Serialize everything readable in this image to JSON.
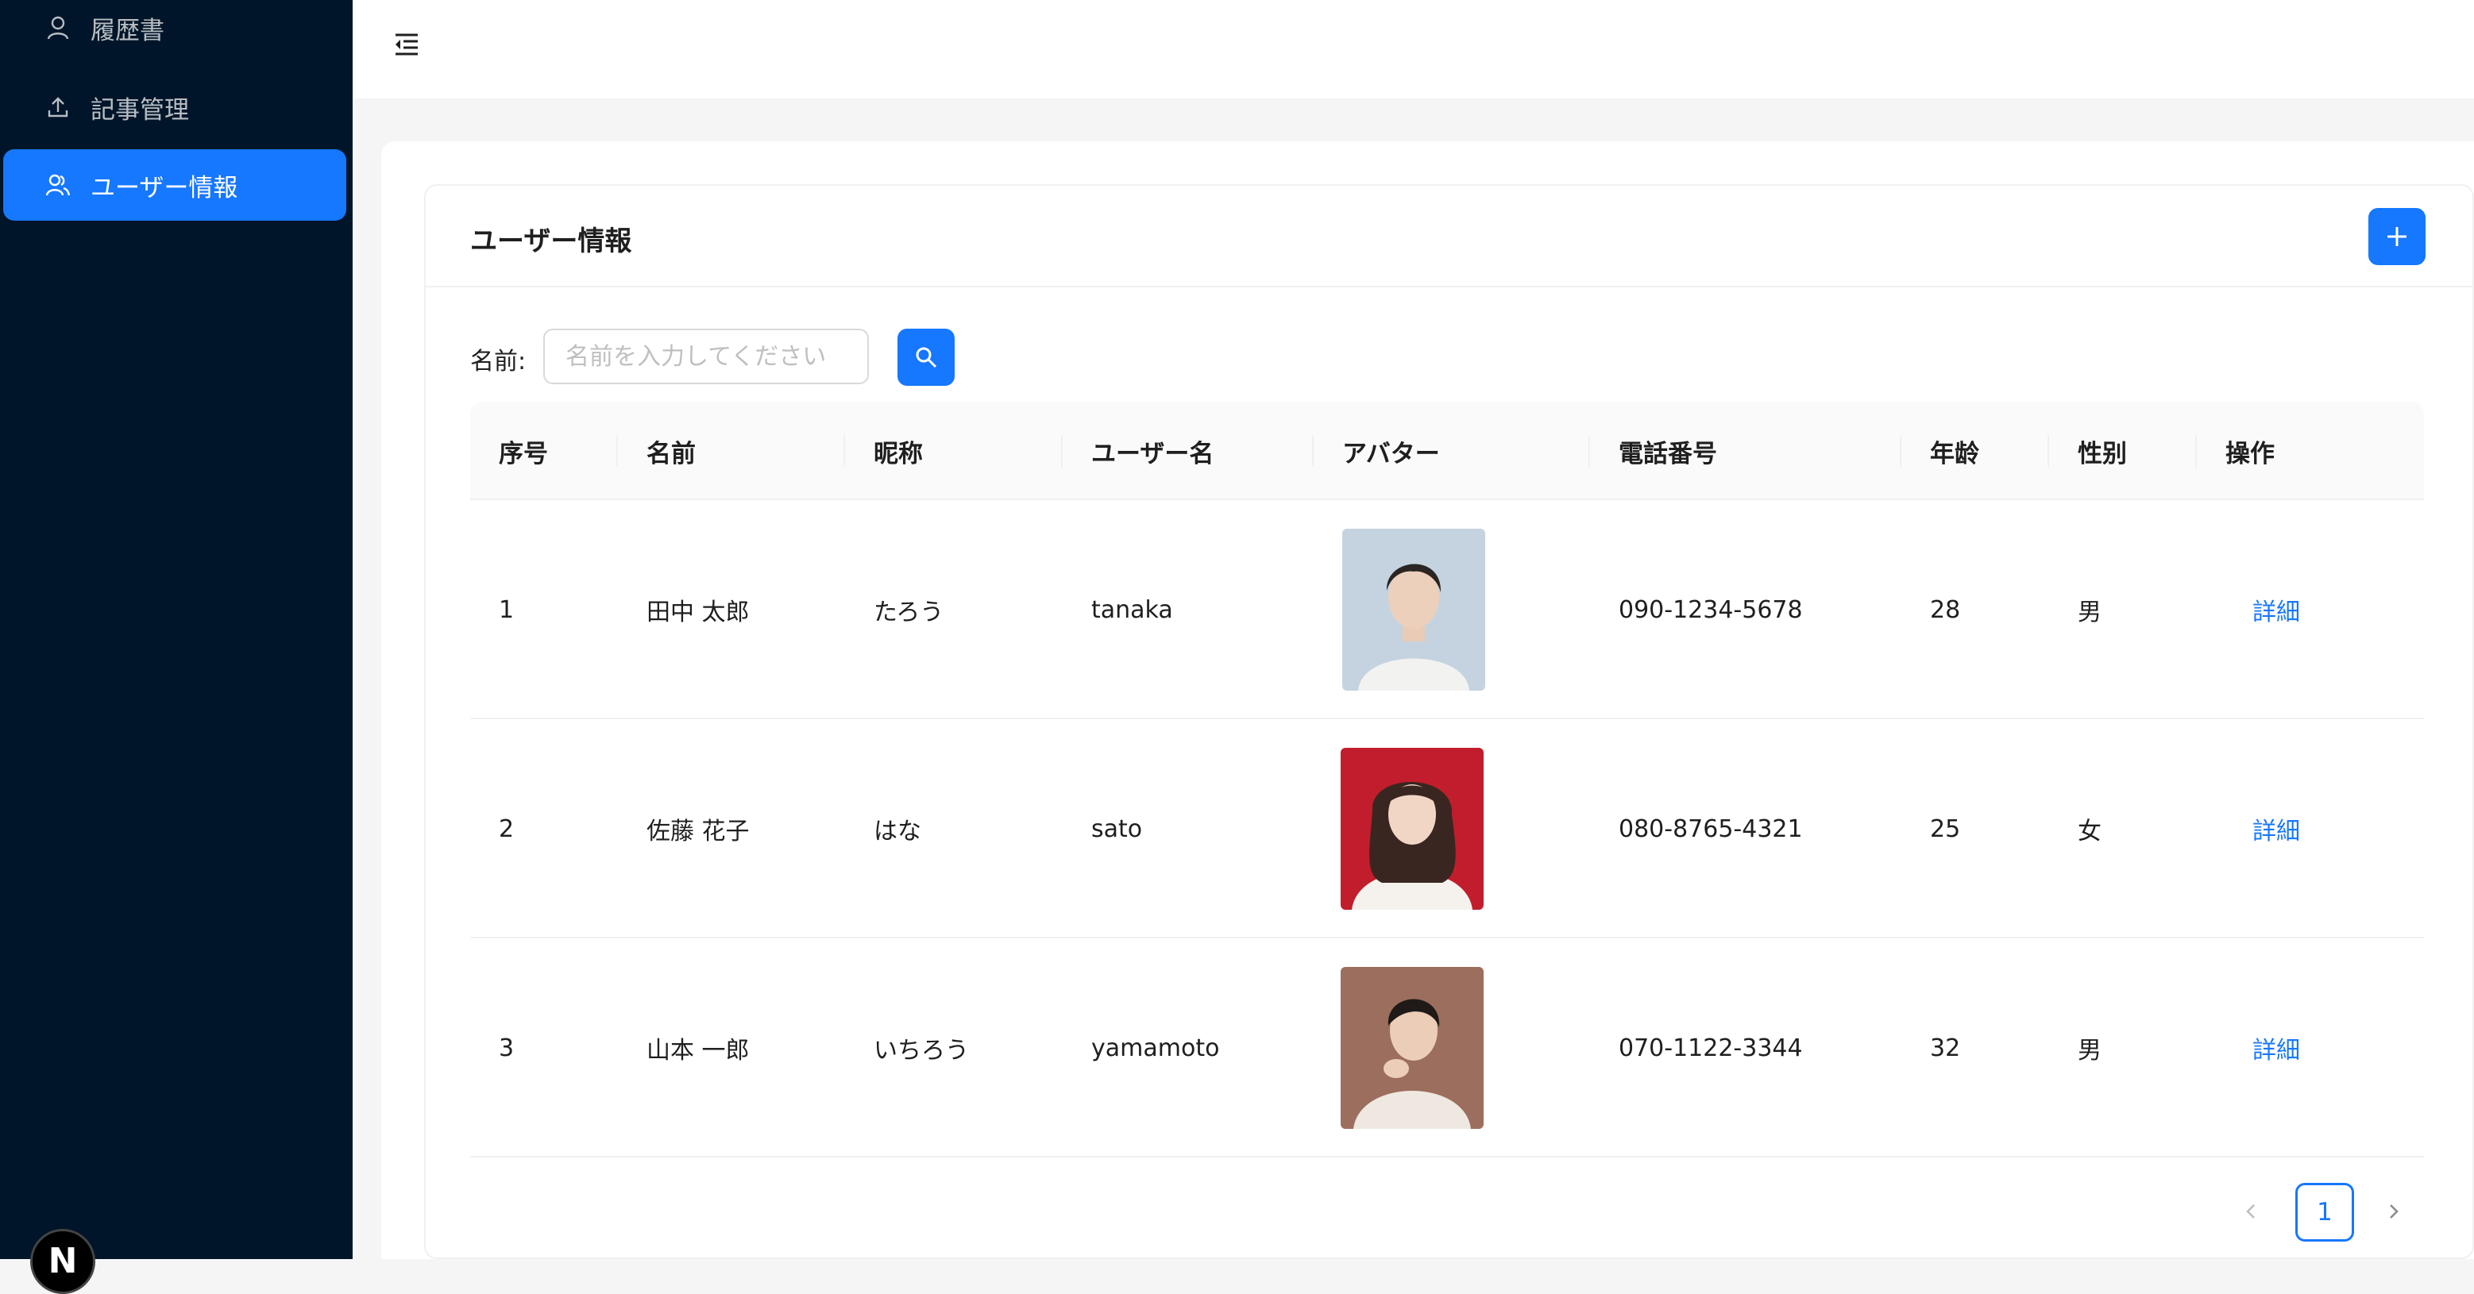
{
  "sidebar": {
    "items": [
      {
        "label": "履歴書",
        "icon": "user-icon"
      },
      {
        "label": "記事管理",
        "icon": "upload-icon"
      },
      {
        "label": "ユーザー情報",
        "icon": "team-icon",
        "active": true
      }
    ],
    "avatar_letter": "N"
  },
  "header": {
    "collapse_icon": "menu-fold-icon"
  },
  "card": {
    "title": "ユーザー情報",
    "add_icon": "plus-icon"
  },
  "search": {
    "label": "名前:",
    "placeholder": "名前を入力してください",
    "value": "",
    "button_icon": "search-icon"
  },
  "table": {
    "columns": [
      "序号",
      "名前",
      "昵称",
      "ユーザー名",
      "アバター",
      "電話番号",
      "年龄",
      "性别",
      "操作"
    ],
    "rows": [
      {
        "no": "1",
        "name": "田中 太郎",
        "nickname": "たろう",
        "username": "tanaka",
        "phone": "090-1234-5678",
        "age": "28",
        "gender": "男",
        "action": "詳細",
        "avatar_bg": "#b9c9d6"
      },
      {
        "no": "2",
        "name": "佐藤 花子",
        "nickname": "はな",
        "username": "sato",
        "phone": "080-8765-4321",
        "age": "25",
        "gender": "女",
        "action": "詳細",
        "avatar_bg": "#c8202e"
      },
      {
        "no": "3",
        "name": "山本 一郎",
        "nickname": "いちろう",
        "username": "yamamoto",
        "phone": "070-1122-3344",
        "age": "32",
        "gender": "男",
        "action": "詳細",
        "avatar_bg": "#8a5a4a"
      }
    ]
  },
  "pagination": {
    "current": "1",
    "prev_icon": "chevron-left-icon",
    "next_icon": "chevron-right-icon"
  },
  "colors": {
    "primary": "#1677ff",
    "sidebar_bg": "#001529"
  }
}
